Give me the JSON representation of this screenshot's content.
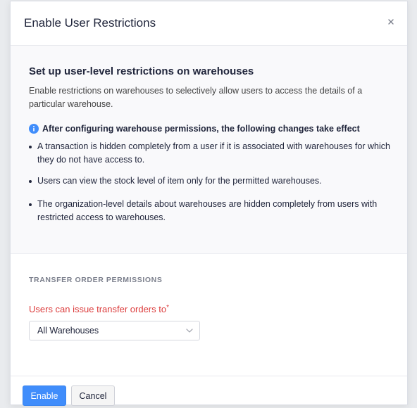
{
  "modal": {
    "title": "Enable User Restrictions",
    "close_icon": "close-icon"
  },
  "info": {
    "heading": "Set up user-level restrictions on warehouses",
    "description": "Enable restrictions on warehouses to selectively allow users to access the details of a particular warehouse.",
    "notice_icon": "info-icon",
    "notice_icon_color": "#408dfb",
    "notice": "After configuring warehouse permissions, the following changes take effect",
    "bullets": [
      "A transaction is hidden completely from a user if it is associated with warehouses for which they do not have access to.",
      "Users can view the stock level of item only for the permitted warehouses.",
      "The organization-level details about warehouses are hidden completely from users with restricted access to warehouses."
    ]
  },
  "permissions": {
    "heading": "TRANSFER ORDER PERMISSIONS",
    "field_label": "Users can issue transfer orders to",
    "required_marker": "*",
    "label_color": "#dc3c3c",
    "select_value": "All Warehouses",
    "select_icon": "chevron-down-icon"
  },
  "footer": {
    "enable_label": "Enable",
    "cancel_label": "Cancel",
    "primary_color": "#408dfb"
  }
}
